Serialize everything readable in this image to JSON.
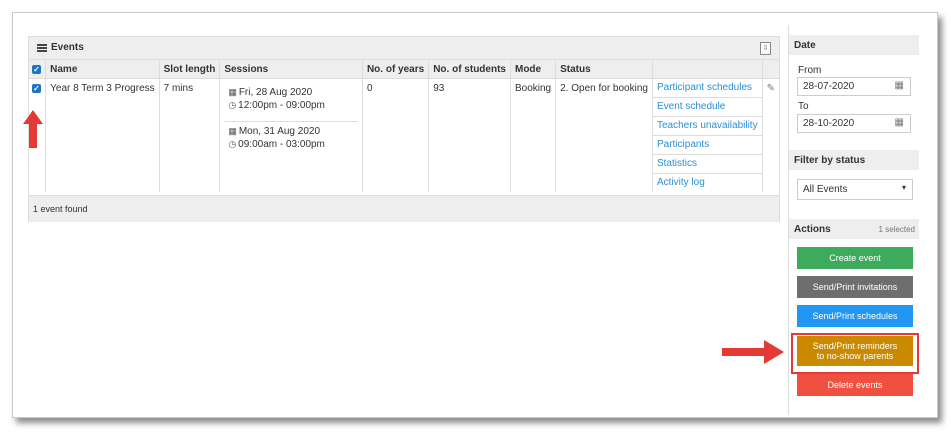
{
  "events_panel": {
    "title": "Events",
    "columns": [
      "Name",
      "Slot length",
      "Sessions",
      "No. of years",
      "No. of students",
      "Mode",
      "Status"
    ],
    "row": {
      "name": "Year 8 Term 3 Progress",
      "slot_length": "7 mins",
      "sessions": [
        {
          "date": "Fri, 28 Aug 2020",
          "time": "12:00pm - 09:00pm"
        },
        {
          "date": "Mon, 31 Aug 2020",
          "time": "09:00am - 03:00pm"
        }
      ],
      "years": "0",
      "students": "93",
      "mode": "Booking",
      "status": "2. Open for booking",
      "links": [
        "Participant schedules",
        "Event schedule",
        "Teachers unavailability",
        "Participants",
        "Statistics",
        "Activity log"
      ]
    },
    "footer": "1 event found"
  },
  "sidebar": {
    "date_title": "Date",
    "from_label": "From",
    "from_value": "28-07-2020",
    "to_label": "To",
    "to_value": "28-10-2020",
    "filter_title": "Filter by status",
    "filter_value": "All Events",
    "actions_title": "Actions",
    "selected_count": "1 selected",
    "buttons": [
      {
        "label": "Create event",
        "color": "#3daa5c"
      },
      {
        "label": "Send/Print invitations",
        "color": "#6e6e6e"
      },
      {
        "label": "Send/Print schedules",
        "color": "#2196f3"
      },
      {
        "label_line1": "Send/Print reminders",
        "label_line2": "to no-show parents",
        "color": "#c98a00"
      },
      {
        "label": "Delete events",
        "color": "#f05040"
      }
    ]
  },
  "colors": {
    "accent": "#1d74c6",
    "link": "#2a8fd4",
    "highlight": "#e53935"
  },
  "icons": [
    "list-icon",
    "export-icon",
    "checkbox-icon",
    "calendar-icon",
    "clock-icon",
    "edit-icon",
    "dropdown-caret-icon"
  ]
}
